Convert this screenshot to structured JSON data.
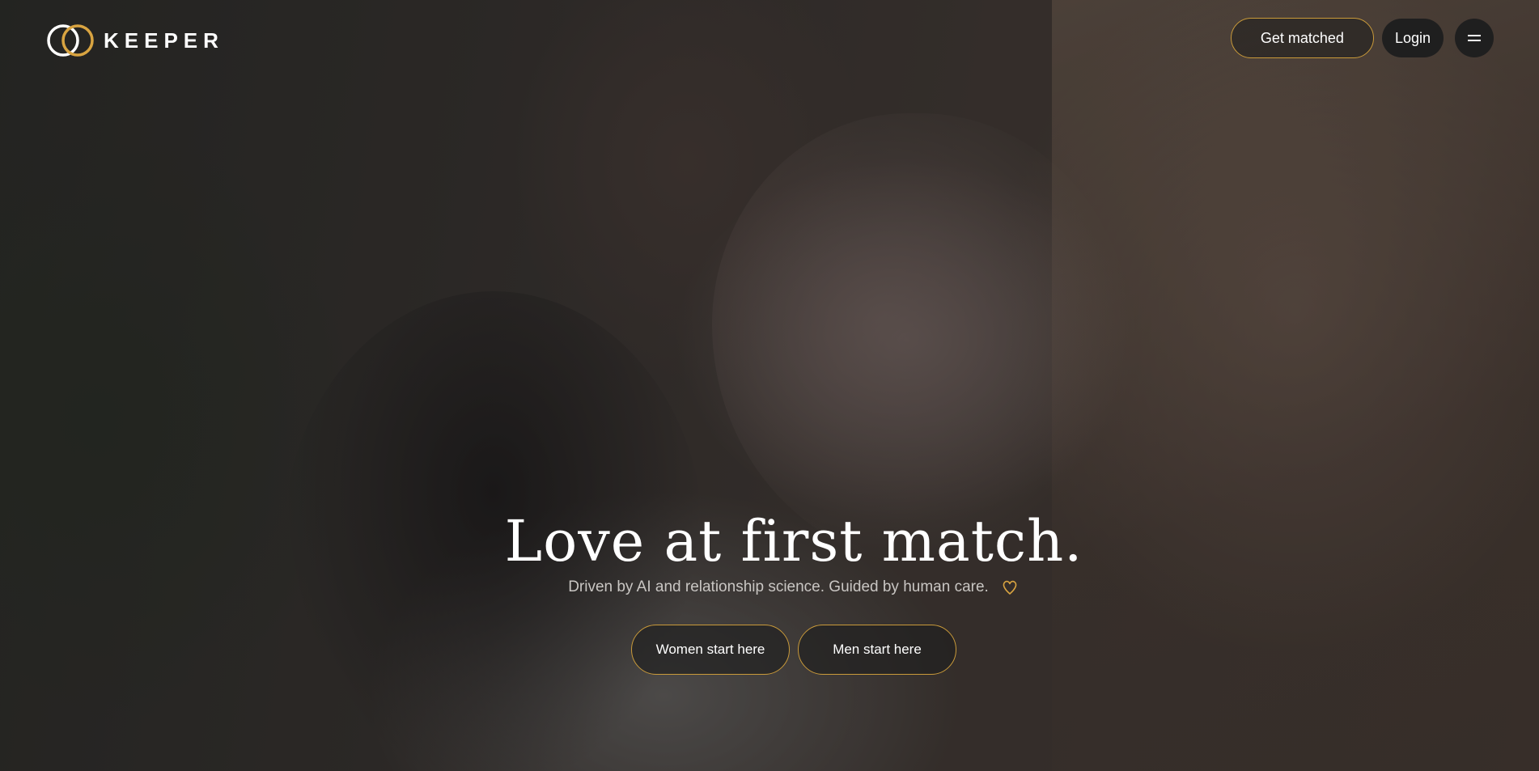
{
  "brand": {
    "name": "KEEPER",
    "accent_color": "#c99a3a"
  },
  "nav": {
    "get_matched_label": "Get matched",
    "login_label": "Login",
    "menu_icon": "hamburger-menu-icon"
  },
  "hero": {
    "headline": "Love at first match.",
    "subline": "Driven by AI and relationship science. Guided by human care.",
    "subline_icon": "heart-icon",
    "cta_women_label": "Women start here",
    "cta_men_label": "Men start here"
  }
}
